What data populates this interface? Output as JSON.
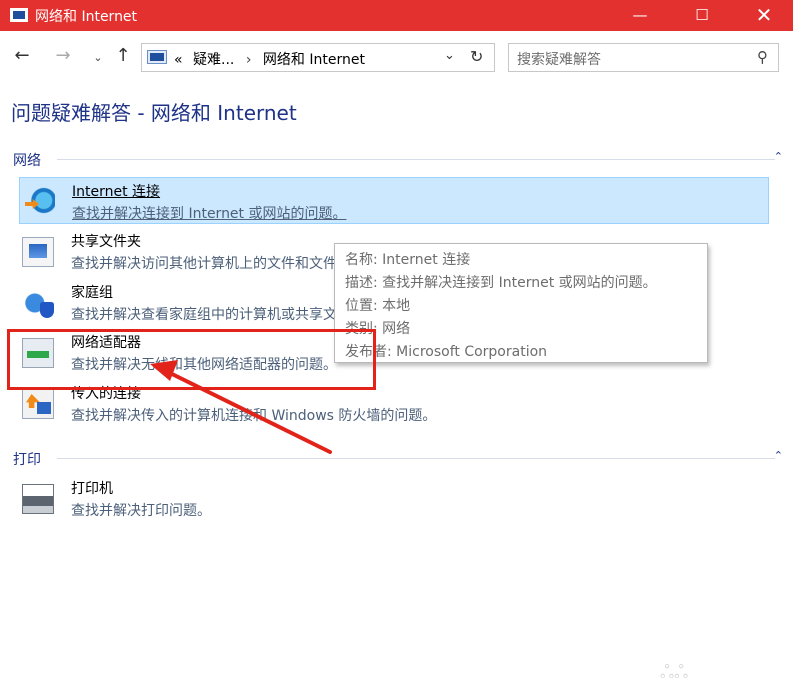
{
  "window": {
    "title": "网络和 Internet",
    "controls": {
      "minimize": "—",
      "maximize": "☐",
      "close": "✕"
    }
  },
  "nav": {
    "back": "←",
    "forward": "→",
    "recent": "⌄",
    "up": "↑"
  },
  "address": {
    "overflow": "«",
    "crumbs": [
      "疑难...",
      "网络和 Internet"
    ],
    "separator": "›",
    "dropdown": "⌄",
    "refresh": "↻"
  },
  "search": {
    "placeholder": "搜索疑难解答",
    "icon": "⚲"
  },
  "heading": "问题疑难解答 - 网络和 Internet",
  "sections": {
    "network": {
      "label": "网络",
      "collapse": "⌃",
      "items": [
        {
          "name": "Internet 连接",
          "desc": "查找并解决连接到 Internet 或网站的问题。",
          "icon": "internet-connection-icon"
        },
        {
          "name": "共享文件夹",
          "desc": "查找并解决访问其他计算机上的文件和文件夹的问题。",
          "icon": "shared-folder-icon"
        },
        {
          "name": "家庭组",
          "desc": "查找并解决查看家庭组中的计算机或共享文件的问题。",
          "icon": "homegroup-icon"
        },
        {
          "name": "网络适配器",
          "desc": "查找并解决无线和其他网络适配器的问题。",
          "icon": "network-adapter-icon"
        },
        {
          "name": "传入的连接",
          "desc": "查找并解决传入的计算机连接和 Windows 防火墙的问题。",
          "icon": "incoming-connection-icon"
        }
      ]
    },
    "printing": {
      "label": "打印",
      "collapse": "⌃",
      "items": [
        {
          "name": "打印机",
          "desc": "查找并解决打印问题。",
          "icon": "printer-icon"
        }
      ]
    }
  },
  "tooltip": {
    "line1": "名称: Internet 连接",
    "line2": "描述: 查找并解决连接到 Internet 或网站的问题。",
    "line3": "位置: 本地",
    "line4": "类别: 网络",
    "line5": "发布者: Microsoft Corporation"
  },
  "colors": {
    "titlebar": "#e3312f",
    "heading": "#1e3287",
    "selection": "#cce8ff",
    "annotation": "#e2231a"
  },
  "watermark": "ஃஃ"
}
